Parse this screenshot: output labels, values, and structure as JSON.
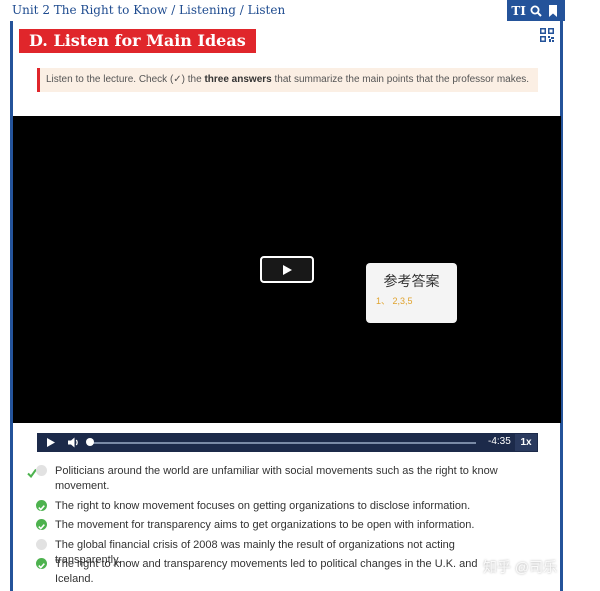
{
  "breadcrumb": "Unit 2 The Right to Know / Listening / Listen",
  "toolbar": {
    "text_tool_label": "TI"
  },
  "section_title": "D. Listen for Main Ideas",
  "instruction": {
    "before": "Listen to the lecture. Check (✓) the ",
    "bold": "three answers",
    "after": " that summarize the main points that the professor makes."
  },
  "overlay": {
    "title": "参考答案",
    "value": "1、 2,3,5"
  },
  "player": {
    "time": "-4:35",
    "rate": "1x",
    "progress": 0.0
  },
  "options": [
    {
      "text": "Politicians around the world are unfamiliar with social movements such as the right to know movement.",
      "checked": false
    },
    {
      "text": "The right to know movement focuses on getting organizations to disclose information.",
      "checked": true
    },
    {
      "text": "The movement for transparency aims to get organizations to be open with information.",
      "checked": true
    },
    {
      "text": "The global financial crisis of 2008 was mainly the result of organizations not acting transparently.",
      "checked": false
    },
    {
      "text": "The right to know and transparency movements led to political changes in the U.K. and Iceland.",
      "checked": true
    }
  ],
  "watermark": "知乎 @司乐",
  "colors": {
    "brand_blue": "#24539a",
    "title_red": "#e0262b",
    "check_green": "#4db24e",
    "overlay_gold": "#e0a32e"
  }
}
